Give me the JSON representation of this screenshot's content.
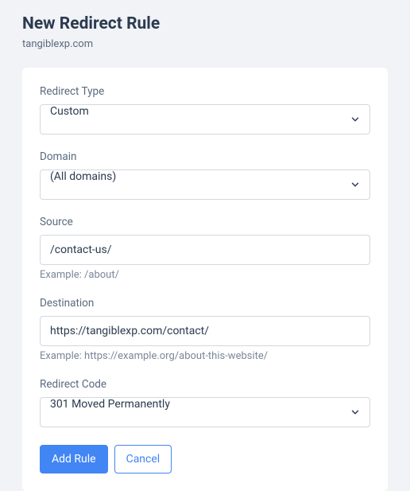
{
  "header": {
    "title": "New Redirect Rule",
    "subtitle": "tangiblexp.com"
  },
  "form": {
    "redirect_type": {
      "label": "Redirect Type",
      "value": "Custom"
    },
    "domain": {
      "label": "Domain",
      "value": "(All domains)"
    },
    "source": {
      "label": "Source",
      "value": "/contact-us/",
      "help": "Example: /about/"
    },
    "destination": {
      "label": "Destination",
      "value": "https://tangiblexp.com/contact/",
      "help": "Example: https://example.org/about-this-website/"
    },
    "redirect_code": {
      "label": "Redirect Code",
      "value": "301 Moved Permanently"
    }
  },
  "buttons": {
    "add": "Add Rule",
    "cancel": "Cancel"
  }
}
